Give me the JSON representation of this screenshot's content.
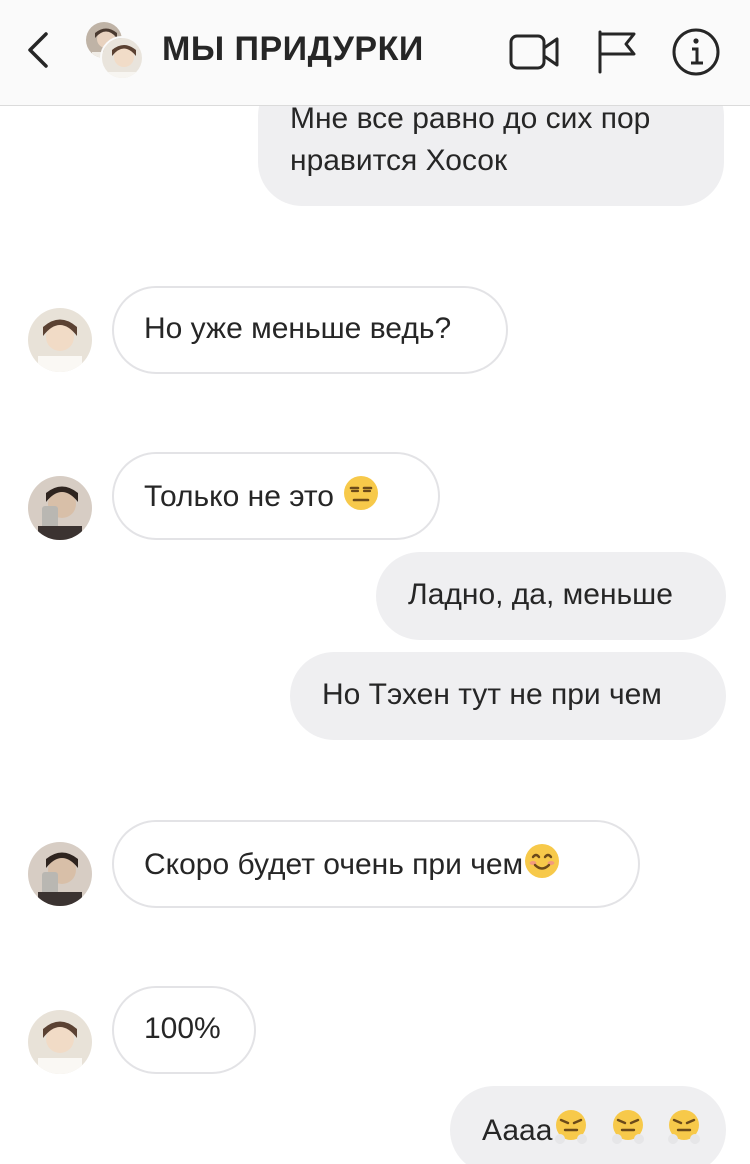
{
  "header": {
    "title": "МЫ ПРИДУРКИ",
    "icons": [
      "back-icon",
      "video-call-icon",
      "flag-icon",
      "info-icon"
    ]
  },
  "messages": [
    {
      "direction": "outgoing",
      "lines": [
        "Мне все равно до сих пор",
        "нравится Хосок"
      ]
    },
    {
      "direction": "incoming",
      "sender_avatar": "avatar-light",
      "text": "Но уже меньше ведь?"
    },
    {
      "direction": "incoming",
      "sender_avatar": "avatar-dark",
      "text": "Только не это",
      "emoji": [
        "expressionless-face"
      ]
    },
    {
      "direction": "outgoing",
      "text": "Ладно, да, меньше"
    },
    {
      "direction": "outgoing",
      "text": "Но Тэхен тут не при чем"
    },
    {
      "direction": "incoming",
      "sender_avatar": "avatar-dark",
      "text": "Скоро будет очень при чем",
      "emoji": [
        "smiling-face"
      ]
    },
    {
      "direction": "incoming",
      "sender_avatar": "avatar-light",
      "text": "100%"
    },
    {
      "direction": "outgoing",
      "text": "Аааа",
      "emoji": [
        "steam-face",
        "steam-face",
        "steam-face"
      ]
    }
  ],
  "colors": {
    "header_bg": "#fafafa",
    "outgoing_bubble": "#efeff1",
    "incoming_border": "#e3e3e6",
    "text": "#262626",
    "emoji_yellow": "#f7c94a"
  }
}
